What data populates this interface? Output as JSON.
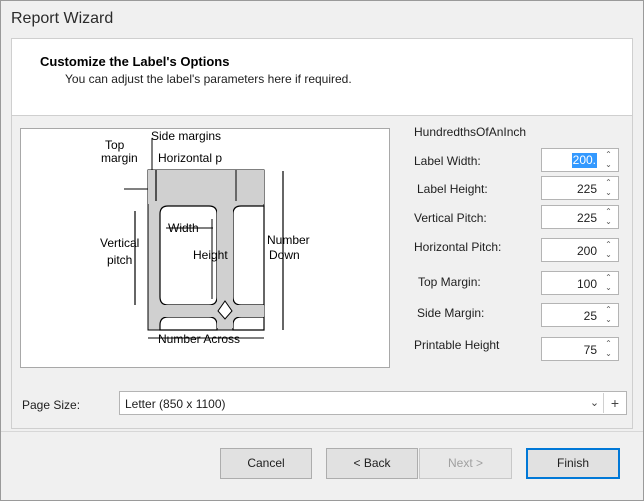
{
  "window": {
    "title": "Report Wizard"
  },
  "header": {
    "title": "Customize the Label's Options",
    "subtitle": "You can adjust the label's parameters here if required."
  },
  "diagram": {
    "top_margin_line1": "Top",
    "top_margin_line2": "margin",
    "side_margins": "Side margins",
    "horizontal_pitch": "Horizontal p",
    "width": "Width",
    "height": "Height",
    "vertical_pitch_line1": "Vertical",
    "vertical_pitch_line2": "pitch",
    "number_down_line1": "Number",
    "number_down_line2": "Down",
    "number_across": "Number Across"
  },
  "units": "HundredthsOfAnInch",
  "fields": {
    "label_width": {
      "label": "Label Width:",
      "value": "200."
    },
    "label_height": {
      "label": "Label Height:",
      "value": "225"
    },
    "vertical_pitch": {
      "label": "Vertical Pitch:",
      "value": "225"
    },
    "horizontal_pitch": {
      "label": "Horizontal Pitch:",
      "value": "200"
    },
    "top_margin": {
      "label": "Top Margin:",
      "value": "100"
    },
    "side_margin": {
      "label": "Side Margin:",
      "value": "25"
    },
    "printable_height": {
      "label": "Printable Height",
      "value": "75"
    }
  },
  "page_size": {
    "label": "Page Size:",
    "value": "Letter (850 x 1100)"
  },
  "icons": {
    "spin_up": "chevron-up-icon",
    "spin_down": "chevron-down-icon",
    "dropdown": "chevron-down-icon",
    "add": "plus-icon"
  },
  "buttons": {
    "cancel": "Cancel",
    "back": "< Back",
    "next": "Next >",
    "finish": "Finish"
  },
  "colors": {
    "accent": "#0078d7",
    "selection": "#3399ff"
  }
}
